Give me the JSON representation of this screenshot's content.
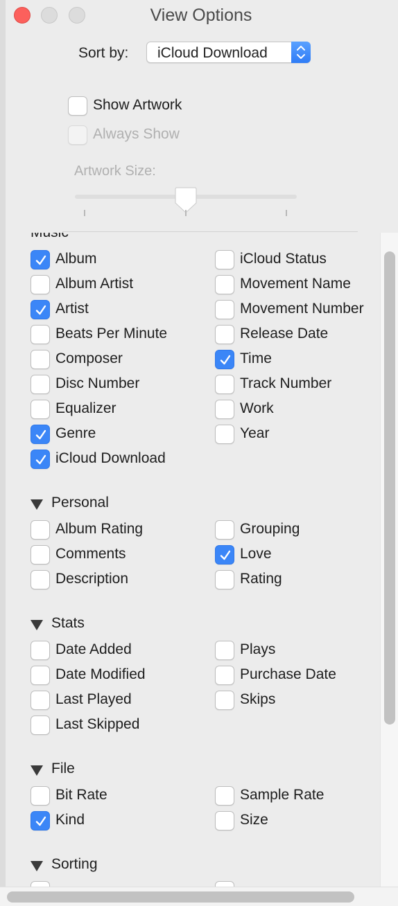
{
  "window": {
    "title": "View Options",
    "traffic_lights": {
      "close_color": "#fc605c",
      "inactive_color": "#dcdcdc"
    }
  },
  "sort": {
    "label": "Sort by:",
    "value": "iCloud Download"
  },
  "artwork": {
    "show_artwork": {
      "label": "Show Artwork",
      "checked": false
    },
    "always_show": {
      "label": "Always Show",
      "checked": false,
      "enabled": false
    },
    "size_label": "Artwork Size:",
    "size_value": 0.5
  },
  "sections": {
    "music": {
      "label": "Music",
      "left": [
        {
          "label": "Album",
          "checked": true
        },
        {
          "label": "Album Artist",
          "checked": false
        },
        {
          "label": "Artist",
          "checked": true
        },
        {
          "label": "Beats Per Minute",
          "checked": false
        },
        {
          "label": "Composer",
          "checked": false
        },
        {
          "label": "Disc Number",
          "checked": false
        },
        {
          "label": "Equalizer",
          "checked": false
        },
        {
          "label": "Genre",
          "checked": true
        },
        {
          "label": "iCloud Download",
          "checked": true
        }
      ],
      "right": [
        {
          "label": "iCloud Status",
          "checked": false
        },
        {
          "label": "Movement Name",
          "checked": false
        },
        {
          "label": "Movement Number",
          "checked": false
        },
        {
          "label": "Release Date",
          "checked": false
        },
        {
          "label": "Time",
          "checked": true
        },
        {
          "label": "Track Number",
          "checked": false
        },
        {
          "label": "Work",
          "checked": false
        },
        {
          "label": "Year",
          "checked": false
        }
      ]
    },
    "personal": {
      "label": "Personal",
      "left": [
        {
          "label": "Album Rating",
          "checked": false
        },
        {
          "label": "Comments",
          "checked": false
        },
        {
          "label": "Description",
          "checked": false
        }
      ],
      "right": [
        {
          "label": "Grouping",
          "checked": false
        },
        {
          "label": "Love",
          "checked": true
        },
        {
          "label": "Rating",
          "checked": false
        }
      ]
    },
    "stats": {
      "label": "Stats",
      "left": [
        {
          "label": "Date Added",
          "checked": false
        },
        {
          "label": "Date Modified",
          "checked": false
        },
        {
          "label": "Last Played",
          "checked": false
        },
        {
          "label": "Last Skipped",
          "checked": false
        }
      ],
      "right": [
        {
          "label": "Plays",
          "checked": false
        },
        {
          "label": "Purchase Date",
          "checked": false
        },
        {
          "label": "Skips",
          "checked": false
        }
      ]
    },
    "file": {
      "label": "File",
      "left": [
        {
          "label": "Bit Rate",
          "checked": false
        },
        {
          "label": "Kind",
          "checked": true
        }
      ],
      "right": [
        {
          "label": "Sample Rate",
          "checked": false
        },
        {
          "label": "Size",
          "checked": false
        }
      ]
    },
    "sorting": {
      "label": "Sorting"
    }
  },
  "colors": {
    "accent": "#3b86f7",
    "window_bg": "#ececec"
  },
  "scrollbars": {
    "vertical_position": 0.0,
    "horizontal_position": 0.0
  }
}
